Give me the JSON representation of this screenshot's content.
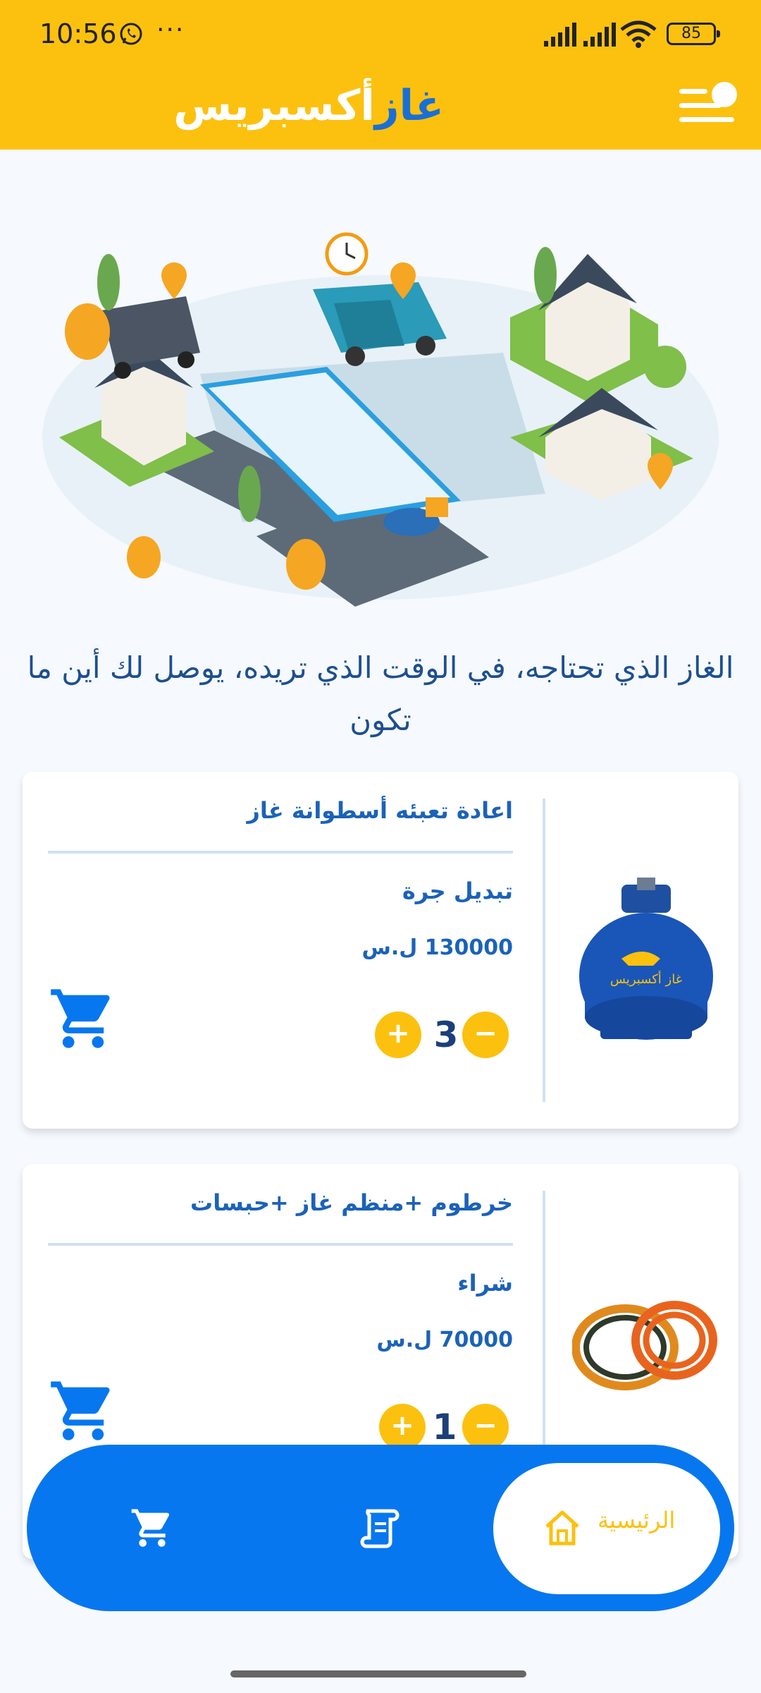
{
  "status_bar": {
    "time": "10:56",
    "more": "···",
    "battery": "85"
  },
  "header": {
    "brand_part1": "غاز",
    "brand_part2": "أكسبريس"
  },
  "hero": {
    "tagline": "الغاز الذي تحتاجه، في الوقت الذي تريده، يوصل لك أين ما تكون"
  },
  "products": [
    {
      "title": "اعادة تعبئه أسطوانة غاز",
      "subtitle": "تبديل جرة",
      "price": "130000 ل.س",
      "quantity": "3",
      "image_label": "غاز أكسبريس"
    },
    {
      "title": "خرطوم +منظم غاز +حبسات",
      "subtitle": "شراء",
      "price": "70000 ل.س",
      "quantity": "1"
    }
  ],
  "qty_controls": {
    "plus": "+",
    "minus": "−"
  },
  "bottom_nav": {
    "home_label": "الرئيسية"
  },
  "colors": {
    "brand_yellow": "#fcc10f",
    "brand_blue": "#0777ef",
    "text_blue": "#1b62b8"
  }
}
